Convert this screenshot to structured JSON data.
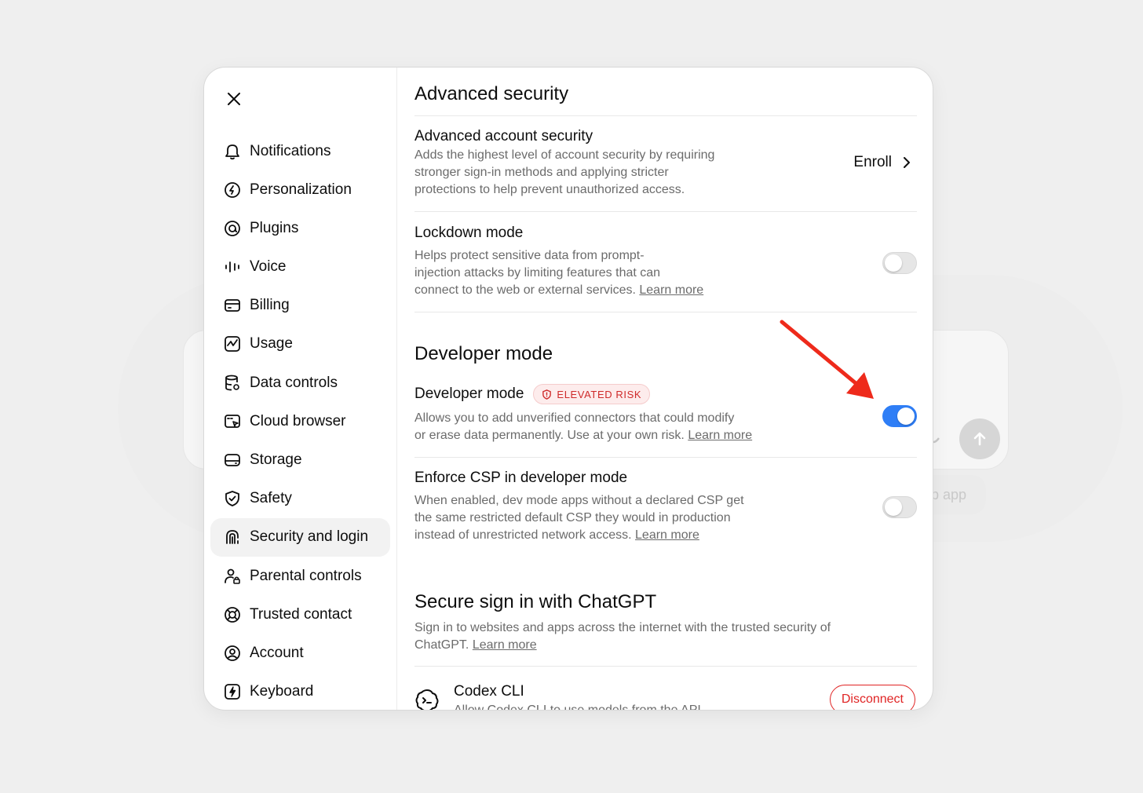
{
  "background": {
    "chip_text": "p app"
  },
  "sidebar": {
    "items": [
      {
        "label": "Notifications",
        "icon": "bell-icon"
      },
      {
        "label": "Personalization",
        "icon": "personalization-icon"
      },
      {
        "label": "Plugins",
        "icon": "plugins-icon"
      },
      {
        "label": "Voice",
        "icon": "voice-waveform-icon"
      },
      {
        "label": "Billing",
        "icon": "credit-card-icon"
      },
      {
        "label": "Usage",
        "icon": "usage-chart-icon"
      },
      {
        "label": "Data controls",
        "icon": "database-gear-icon"
      },
      {
        "label": "Cloud browser",
        "icon": "cloud-browser-icon"
      },
      {
        "label": "Storage",
        "icon": "storage-icon"
      },
      {
        "label": "Safety",
        "icon": "shield-check-icon"
      },
      {
        "label": "Security and login",
        "icon": "security-login-icon",
        "active": true
      },
      {
        "label": "Parental controls",
        "icon": "parental-controls-icon"
      },
      {
        "label": "Trusted contact",
        "icon": "lifebuoy-icon"
      },
      {
        "label": "Account",
        "icon": "account-icon"
      },
      {
        "label": "Keyboard",
        "icon": "keyboard-bolt-icon"
      }
    ]
  },
  "advanced_security": {
    "title": "Advanced security",
    "account_security": {
      "title": "Advanced account security",
      "desc_line1": "Adds the highest level of account security by requiring",
      "desc_line2": "stronger sign-in methods and applying stricter",
      "desc_line3": "protections to help prevent unauthorized access.",
      "action_label": "Enroll"
    },
    "lockdown": {
      "title": "Lockdown mode",
      "desc_line1": "Helps protect sensitive data from prompt-",
      "desc_line2": "injection attacks by limiting features that can",
      "desc_line3": "connect to the web or external services.",
      "learn_more": "Learn more",
      "enabled": false
    }
  },
  "developer_mode": {
    "section_title": "Developer mode",
    "title": "Developer mode",
    "badge": "ELEVATED RISK",
    "desc_line1": "Allows you to add unverified connectors that could modify",
    "desc_line2": "or erase data permanently. Use at your own risk.",
    "learn_more": "Learn more",
    "enabled": true
  },
  "enforce_csp": {
    "title": "Enforce CSP in developer mode",
    "desc_line1": "When enabled, dev mode apps without a declared CSP get",
    "desc_line2": "the same restricted default CSP they would in production",
    "desc_line3": "instead of unrestricted network access.",
    "learn_more": "Learn more",
    "enabled": false
  },
  "secure_signin": {
    "title": "Secure sign in with ChatGPT",
    "desc_line1": "Sign in to websites and apps across the internet with the trusted security of",
    "desc_line2": "ChatGPT.",
    "learn_more": "Learn more"
  },
  "codex": {
    "title": "Codex CLI",
    "desc": "Allow Codex CLI to use models from the API",
    "action_label": "Disconnect"
  },
  "colors": {
    "toggle_on": "#2f7ef6",
    "danger": "#e02424",
    "annotation_arrow": "#ee2a1b"
  }
}
